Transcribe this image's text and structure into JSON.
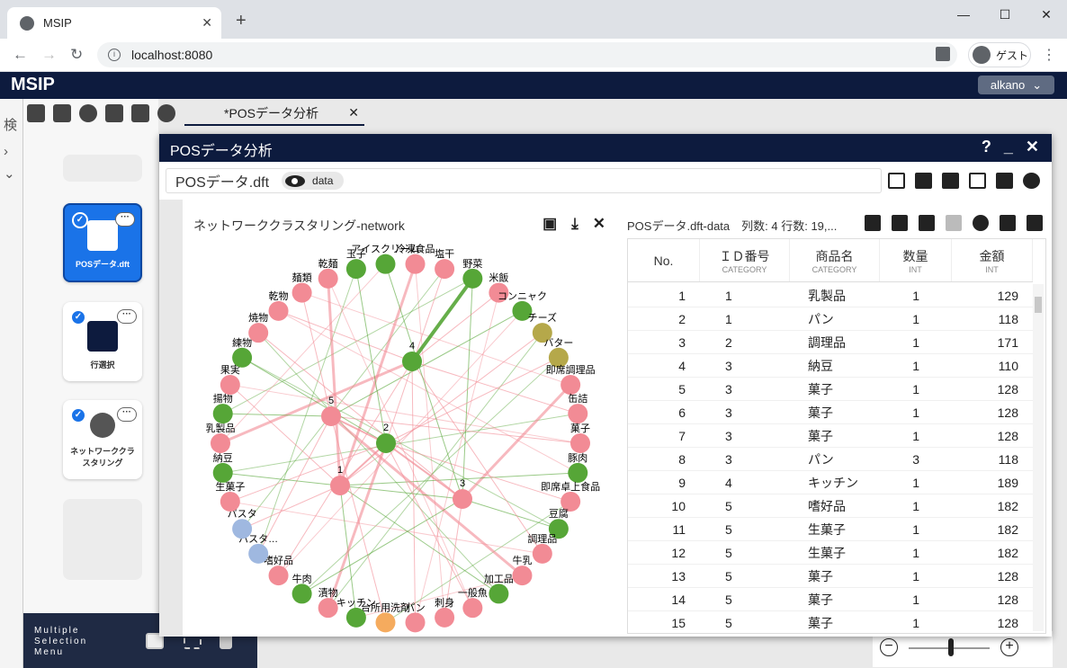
{
  "browser": {
    "tab_title": "MSIP",
    "url": "localhost:8080",
    "guest_label": "ゲスト"
  },
  "app": {
    "title": "MSIP",
    "user": "alkano",
    "doc_tab": "*POSデータ分析"
  },
  "nodes": [
    {
      "label": "POSデータ.dft"
    },
    {
      "label": "行選択"
    },
    {
      "label": "ネットワーククラスタリング"
    }
  ],
  "msm_label": "Multiple Selection Menu",
  "panel": {
    "title": "POSデータ分析",
    "file": "POSデータ.dft",
    "chip": "data"
  },
  "network": {
    "title": "ネットワーククラスタリング-network",
    "clusters": [
      "1",
      "2",
      "3",
      "4",
      "5"
    ],
    "nodes": [
      "冷凍食品",
      "塩干",
      "野菜",
      "米飯",
      "コンニャク",
      "チーズ",
      "バター",
      "即席調理品",
      "缶詰",
      "菓子",
      "豚肉",
      "即席卓上食品",
      "豆腐",
      "調理品",
      "牛乳",
      "加工品",
      "一般魚",
      "刺身",
      "パン",
      "台所用洗剤",
      "キッチン",
      "漬物",
      "牛肉",
      "嗜好品",
      "パスタ…",
      "パスタ",
      "生菓子",
      "納豆",
      "乳製品",
      "揚物",
      "果実",
      "練物",
      "焼物",
      "乾物",
      "麺類",
      "乾麺",
      "玉子",
      "アイスクリーム"
    ]
  },
  "colors": {
    "pink": "#f28b95",
    "green": "#56a637",
    "olive": "#b5a84a",
    "blue": "#9fb8e0",
    "orange": "#f5ab5e"
  },
  "table": {
    "title": "POSデータ.dft-data　列数: 4 行数: 19,...",
    "columns": [
      {
        "name": "No.",
        "type": ""
      },
      {
        "name": "ＩＤ番号",
        "type": "CATEGORY"
      },
      {
        "name": "商品名",
        "type": "CATEGORY"
      },
      {
        "name": "数量",
        "type": "INT"
      },
      {
        "name": "金額",
        "type": "INT"
      }
    ],
    "rows": [
      [
        "1",
        "1",
        "乳製品",
        "1",
        "129"
      ],
      [
        "2",
        "1",
        "パン",
        "1",
        "118"
      ],
      [
        "3",
        "2",
        "調理品",
        "1",
        "171"
      ],
      [
        "4",
        "3",
        "納豆",
        "1",
        "110"
      ],
      [
        "5",
        "3",
        "菓子",
        "1",
        "128"
      ],
      [
        "6",
        "3",
        "菓子",
        "1",
        "128"
      ],
      [
        "7",
        "3",
        "菓子",
        "1",
        "128"
      ],
      [
        "8",
        "3",
        "パン",
        "3",
        "118"
      ],
      [
        "9",
        "4",
        "キッチン",
        "1",
        "189"
      ],
      [
        "10",
        "5",
        "嗜好品",
        "1",
        "182"
      ],
      [
        "11",
        "5",
        "生菓子",
        "1",
        "182"
      ],
      [
        "12",
        "5",
        "生菓子",
        "1",
        "182"
      ],
      [
        "13",
        "5",
        "菓子",
        "1",
        "128"
      ],
      [
        "14",
        "5",
        "菓子",
        "1",
        "128"
      ],
      [
        "15",
        "5",
        "菓子",
        "1",
        "128"
      ]
    ]
  }
}
